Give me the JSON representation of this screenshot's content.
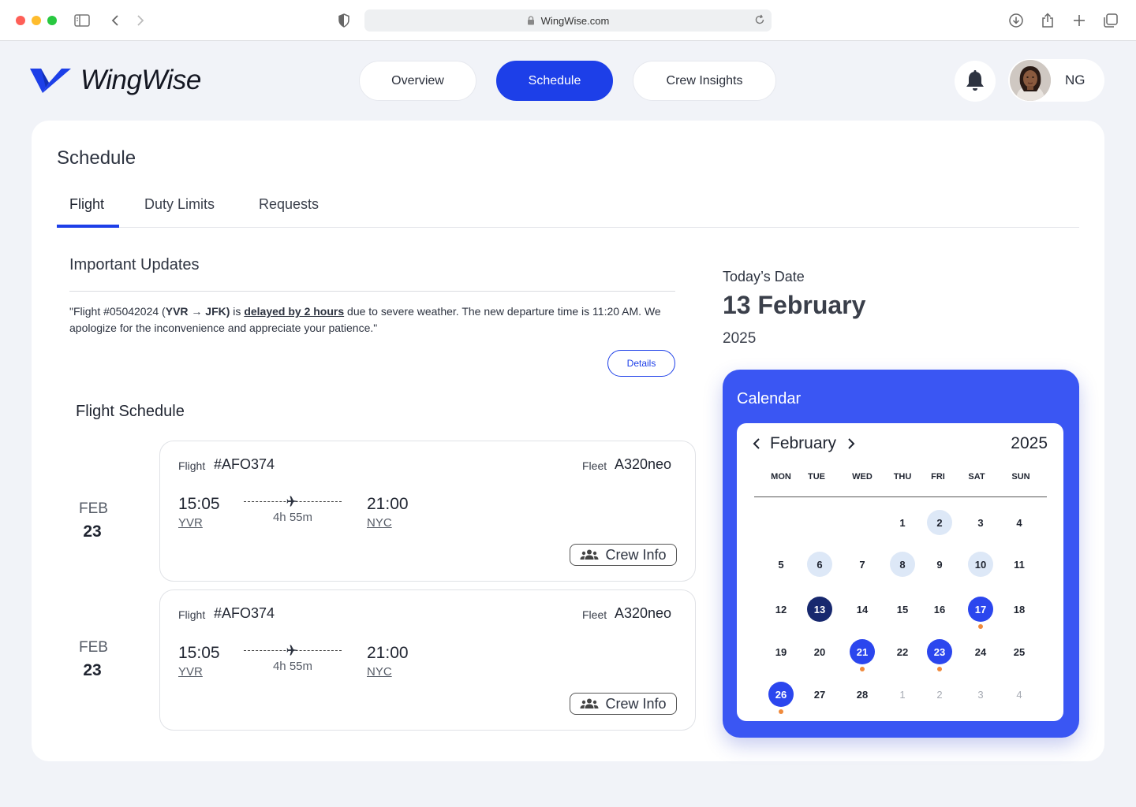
{
  "browser": {
    "url": "WingWise.com"
  },
  "brand": {
    "name": "WingWise",
    "accent": "#1d3fe8"
  },
  "nav": {
    "overview": "Overview",
    "schedule": "Schedule",
    "crew_insights": "Crew Insights",
    "user_initials": "NG"
  },
  "page": {
    "title": "Schedule",
    "tabs": [
      "Flight",
      "Duty Limits",
      "Requests"
    ]
  },
  "updates": {
    "title": "Important Updates",
    "msg_prefix": "\"Flight #05042024  (",
    "msg_route": "YVR → JFK)",
    "msg_is": " is ",
    "msg_delay": "delayed by 2 hours",
    "msg_suffix": " due to severe weather. The new departure time is 11:20 AM. We apologize for the inconvenience and appreciate your patience.\"",
    "details_label": "Details"
  },
  "flight_schedule": {
    "title": "Flight Schedule",
    "flight_label": "Flight",
    "fleet_label": "Fleet",
    "crew_label": "Crew Info",
    "flights": [
      {
        "month": "FEB",
        "day": "23",
        "flight_no": "#AFO374",
        "fleet": "A320neo",
        "dep_time": "15:05",
        "dep_code": "YVR",
        "duration": "4h 55m",
        "arr_time": "21:00",
        "arr_code": "NYC"
      },
      {
        "month": "FEB",
        "day": "23",
        "flight_no": "#AFO374",
        "fleet": "A320neo",
        "dep_time": "15:05",
        "dep_code": "YVR",
        "duration": "4h 55m",
        "arr_time": "21:00",
        "arr_code": "NYC"
      }
    ]
  },
  "today": {
    "label": "Today’s Date",
    "date": "13 February",
    "year": "2025"
  },
  "calendar": {
    "title": "Calendar",
    "month": "February",
    "year": "2025",
    "weekdays": [
      "MON",
      "TUE",
      "WED",
      "THU",
      "FRI",
      "SAT",
      "SUN"
    ],
    "weeks": [
      [
        "",
        "",
        "",
        "1",
        "2",
        "3",
        "4"
      ],
      [
        "5",
        "6",
        "7",
        "8",
        "9",
        "10",
        "11"
      ],
      [
        "12",
        "13",
        "14",
        "15",
        "16",
        "17",
        "18"
      ],
      [
        "19",
        "20",
        "21",
        "22",
        "23",
        "24",
        "25"
      ],
      [
        "26",
        "27",
        "28",
        "1",
        "2",
        "3",
        "4"
      ]
    ],
    "light_highlight_days": [
      "2",
      "6",
      "8",
      "10"
    ],
    "today_day": "13",
    "scheduled_days": [
      "17",
      "21",
      "23",
      "26"
    ],
    "next_month_days": [
      "1",
      "2",
      "3",
      "4"
    ],
    "colors": {
      "panel": "#3a56f3",
      "scheduled": "#2b46ee",
      "today": "#17286e",
      "highlight": "#dde8f7",
      "event_dot": "#f08a3c"
    }
  }
}
